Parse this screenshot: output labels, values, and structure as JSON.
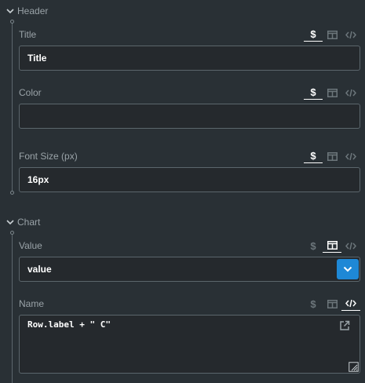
{
  "sections": {
    "header": {
      "title": "Header",
      "fields": {
        "title": {
          "label": "Title",
          "value": "Title",
          "mode": "dollar"
        },
        "color": {
          "label": "Color",
          "value": "",
          "mode": "dollar"
        },
        "font_size": {
          "label": "Font Size (px)",
          "value": "16px",
          "mode": "dollar"
        }
      }
    },
    "chart": {
      "title": "Chart",
      "fields": {
        "value": {
          "label": "Value",
          "selected": "value",
          "mode": "table"
        },
        "name": {
          "label": "Name",
          "code": "Row.label + \" C\"",
          "mode": "code"
        }
      }
    }
  },
  "mode_icons": {
    "dollar": "dollar-icon",
    "table": "table-icon",
    "code": "code-icon"
  },
  "colors": {
    "background": "#293035",
    "input_bg": "#25292d",
    "border": "#5b666c",
    "accent": "#1e88d6",
    "muted_text": "#9aa3a8"
  }
}
